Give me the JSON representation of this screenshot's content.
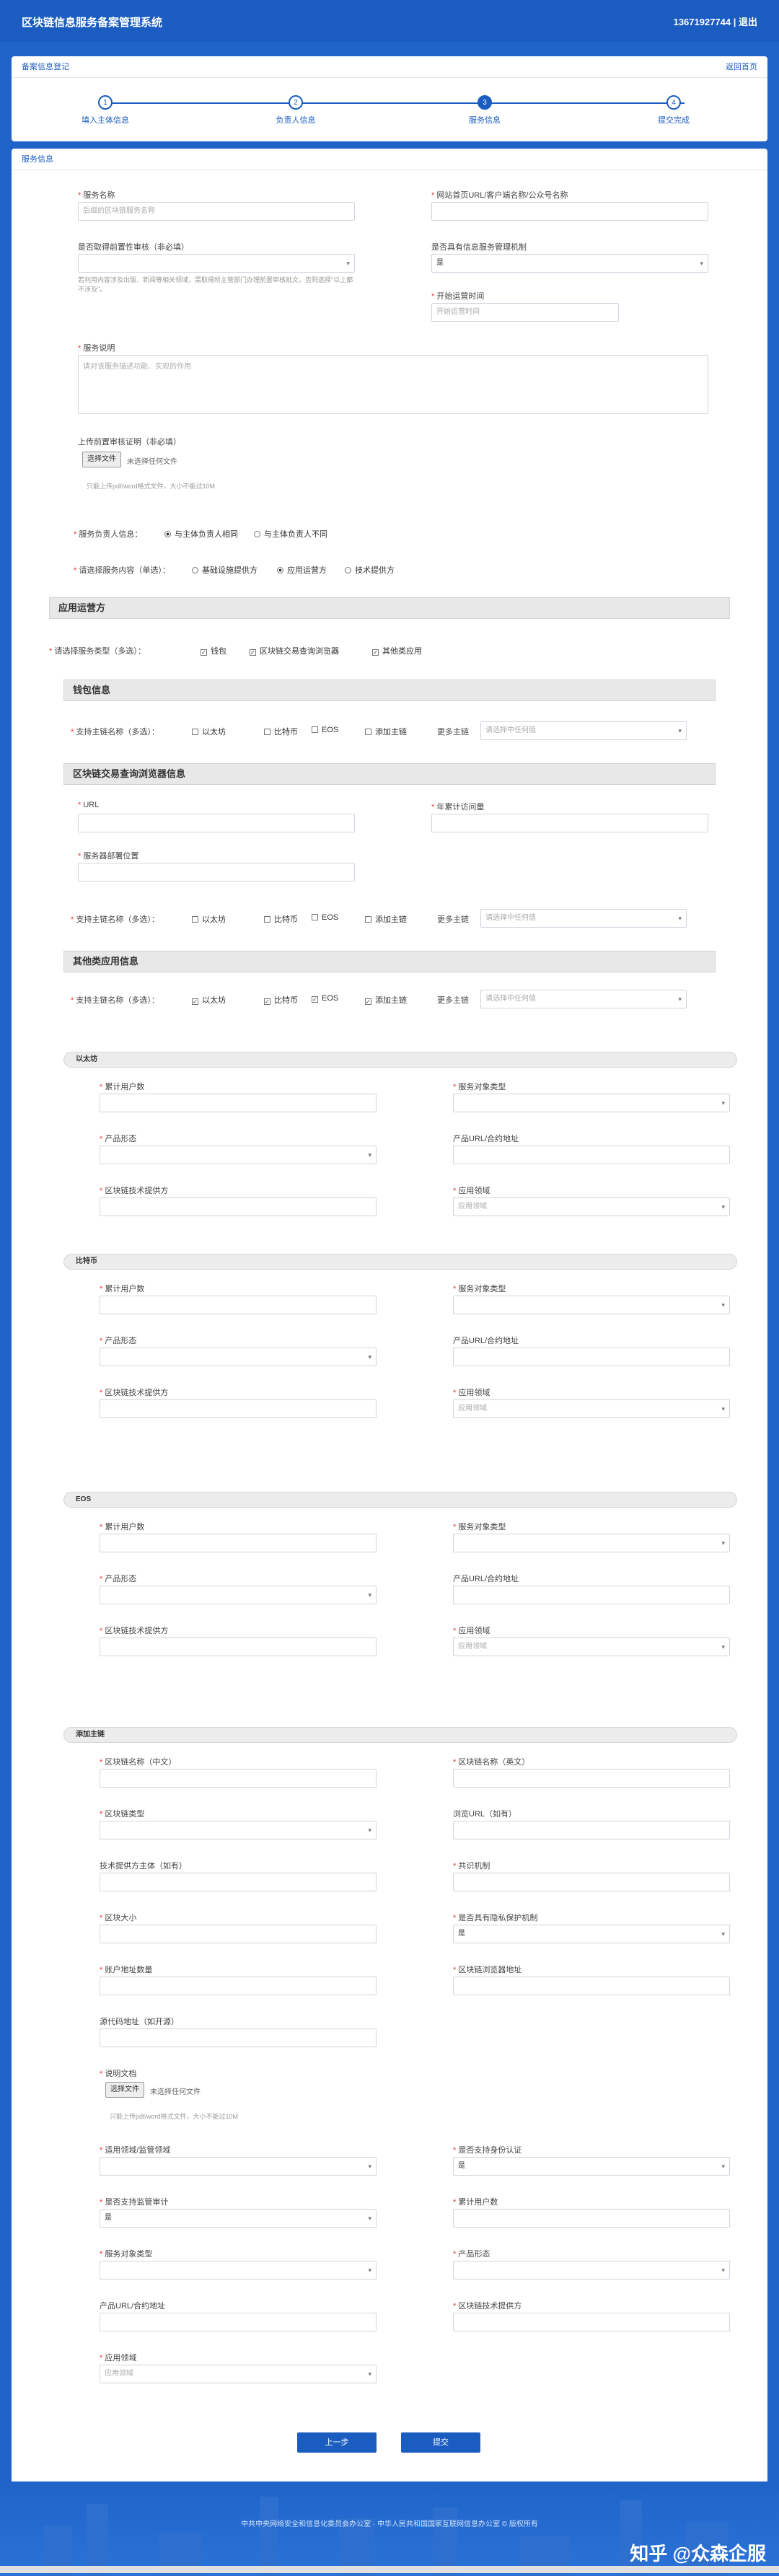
{
  "header": {
    "title": "区块链信息服务备案管理系统",
    "user": "13671927744 | 退出"
  },
  "top_card": {
    "title": "备案信息登记",
    "back": "返回首页",
    "steps": [
      {
        "num": "1",
        "label": "填入主体信息"
      },
      {
        "num": "2",
        "label": "负责人信息"
      },
      {
        "num": "3",
        "label": "服务信息"
      },
      {
        "num": "4",
        "label": "提交完成"
      }
    ]
  },
  "main_card": {
    "title": "服务信息"
  },
  "service": {
    "name_label": "服务名称",
    "name_ph": "后缀的区块链服务名称",
    "url_label": "网站首页URL/客户端名称/公众号名称",
    "approval_label": "是否取得前置性审核（非必填）",
    "approval_hint": "若利用内容涉及出版、新闻等相关领域，需取得所主管部门办理前置审核批文，否则选择\"以上都不涉及\"。",
    "mgmt_label": "是否具有信息服务管理机制",
    "mgmt_value": "是",
    "start_label": "开始运营时间",
    "start_ph": "开始运营时间",
    "desc_label": "服务说明",
    "desc_ph": "请对该服务描述功能、实现的作用",
    "upload_label": "上传前置审核证明（非必填）",
    "upload_btn": "选择文件",
    "upload_none": "未选择任何文件",
    "upload_hint": "只能上传pdf/word格式文件，大小不能过10M",
    "resp_label": "服务负责人信息：",
    "resp_opt1": "与主体负责人相同",
    "resp_opt2": "与主体负责人不同",
    "content_label": "请选择服务内容（单选）：",
    "content_opt1": "基础设施提供方",
    "content_opt2": "应用运营方",
    "content_opt3": "技术提供方"
  },
  "operator": {
    "section_title": "应用运营方",
    "type_label": "请选择服务类型（多选）：",
    "type_opts": [
      "钱包",
      "区块链交易查询浏览器",
      "其他类应用"
    ],
    "wallet_title": "钱包信息",
    "chain_label": "支持主链名称（多选）：",
    "chains": [
      "以太坊",
      "比特币",
      "EOS",
      "添加主链"
    ],
    "more_label": "更多主链",
    "more_ph": "请选择中任何值",
    "explorer_title": "区块链交易查询浏览器信息",
    "url_label": "URL",
    "visits_label": "年累计访问量",
    "deploy_label": "服务器部署位置",
    "other_title": "其他类应用信息"
  },
  "chain_blocks": [
    {
      "title": "以太坊",
      "f1": "累计用户数",
      "f2": "服务对象类型",
      "f3": "产品形态",
      "f4": "产品URL/合约地址",
      "f5": "区块链技术提供方",
      "f6": "应用领域",
      "f6_ph": "应用领域"
    },
    {
      "title": "比特币",
      "f1": "累计用户数",
      "f2": "服务对象类型",
      "f3": "产品形态",
      "f4": "产品URL/合约地址",
      "f5": "区块链技术提供方",
      "f6": "应用领域",
      "f6_ph": "应用领域"
    },
    {
      "title": "EOS",
      "f1": "累计用户数",
      "f2": "服务对象类型",
      "f3": "产品形态",
      "f4": "产品URL/合约地址",
      "f5": "区块链技术提供方",
      "f6": "应用领域",
      "f6_ph": "应用领域"
    }
  ],
  "add_chain": {
    "title": "添加主链",
    "name_cn": "区块链名称（中文）",
    "name_en": "区块链名称（英文）",
    "type": "区块链类型",
    "browser": "浏览URL（如有）",
    "tech": "技术提供方主体（如有）",
    "consensus": "共识机制",
    "size": "区块大小",
    "privacy": "是否具有隐私保护机制",
    "privacy_val": "是",
    "accounts": "账户地址数量",
    "browser_addr": "区块链浏览器地址",
    "code": "源代码地址（如开源）",
    "doc": "说明文档",
    "doc_btn": "选择文件",
    "doc_none": "未选择任何文件",
    "doc_hint": "只能上传pdf/word格式文件，大小不能过10M",
    "regulator": "适用领域/监管领域",
    "identity": "是否支持身份认证",
    "identity_val": "是",
    "audit": "是否支持监管审计",
    "audit_val": "是",
    "users": "累计用户数",
    "service_type": "服务对象类型",
    "form": "产品形态",
    "product_url": "产品URL/合约地址",
    "tech_provider": "区块链技术提供方",
    "field": "应用领域",
    "field_ph": "应用领域"
  },
  "buttons": {
    "prev": "上一步",
    "submit": "提交"
  },
  "footer": {
    "text": "中共中央网络安全和信息化委员会办公室 · 中华人民共和国国家互联网信息办公室 © 版权所有"
  },
  "watermark": "知乎 @众森企服"
}
